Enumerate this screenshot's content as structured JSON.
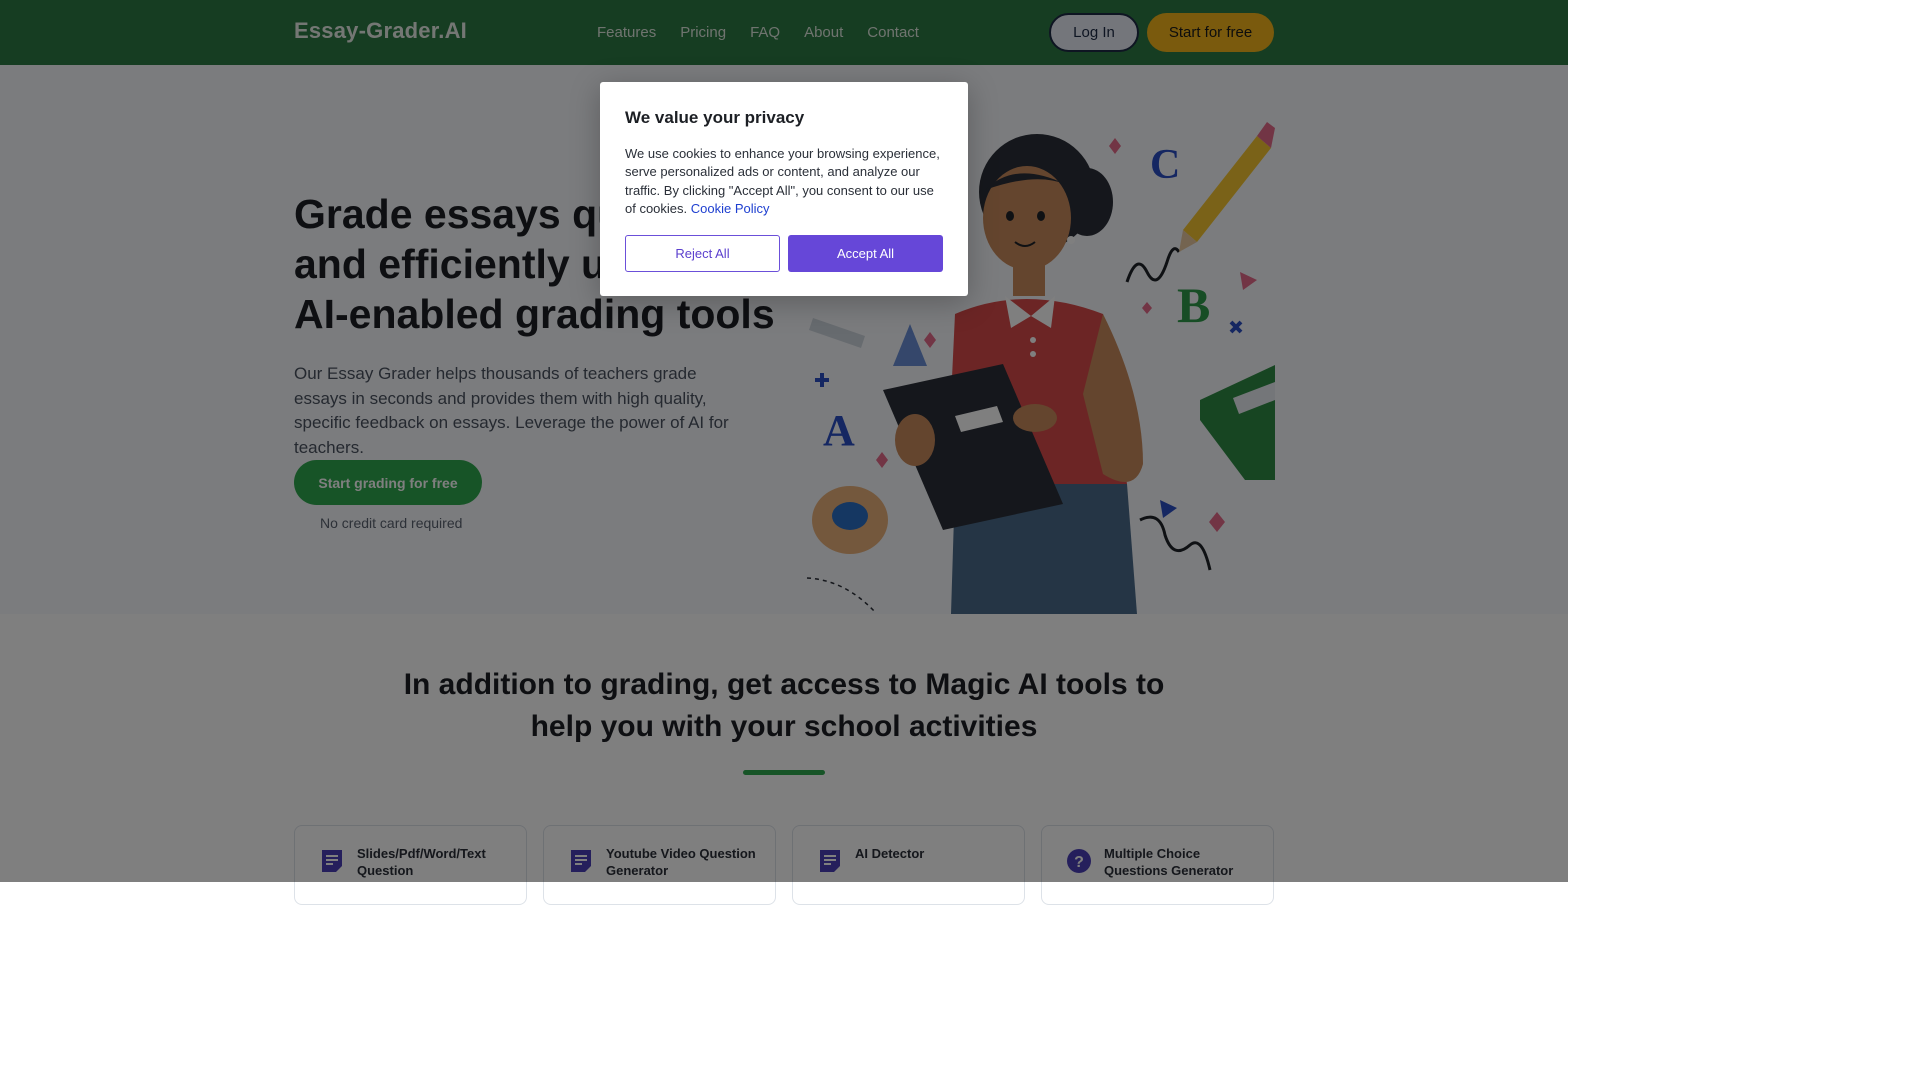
{
  "nav": {
    "logo": "Essay-Grader.AI",
    "links": [
      "Features",
      "Pricing",
      "FAQ",
      "About",
      "Contact"
    ],
    "login_label": "Log In",
    "start_label": "Start for free"
  },
  "hero": {
    "title": "Grade essays quickly and efficiently using our AI-enabled grading tools",
    "description": "Our Essay Grader helps thousands of teachers grade essays in seconds and provides them with high quality, specific feedback on essays. Leverage the power of AI for teachers.",
    "cta_label": "Start grading for free",
    "cta_note": "No credit card required",
    "illustration": "teacher-with-tablet-illustration"
  },
  "tools": {
    "title": "In addition to grading, get access to Magic AI tools to help you with your school activities",
    "cards": [
      {
        "icon": "document-icon",
        "label": "Slides/Pdf/Word/Text Question"
      },
      {
        "icon": "document-icon",
        "label": "Youtube Video Question Generator"
      },
      {
        "icon": "document-icon",
        "label": "AI Detector"
      },
      {
        "icon": "question-circle-icon",
        "label": "Multiple Choice Questions Generator"
      }
    ]
  },
  "cookie_modal": {
    "title": "We value your privacy",
    "body": "We use cookies to enhance your browsing experience, serve personalized ads or content, and analyze our traffic. By clicking \"Accept All\", you consent to our use of cookies.",
    "policy_link": "Cookie Policy",
    "reject_label": "Reject All",
    "accept_label": "Accept All"
  },
  "colors": {
    "nav_bg": "#2d7a45",
    "accent_green": "#2fa84f",
    "start_yellow": "#f4b41a",
    "accept_purple": "#6647d8"
  }
}
